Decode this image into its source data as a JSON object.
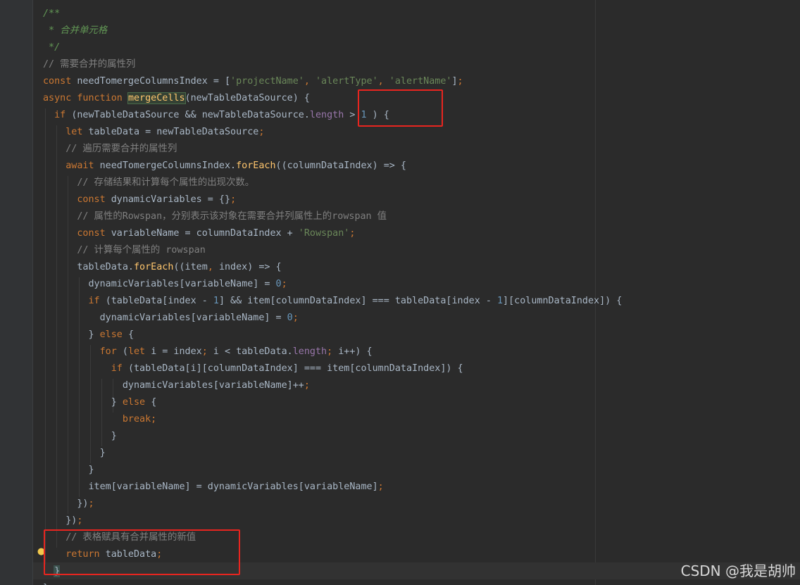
{
  "editor": {
    "theme": "darcula",
    "colors": {
      "background": "#2b2b2b",
      "keyword": "#cc7832",
      "string": "#6a8759",
      "number": "#6897bb",
      "comment": "#808080",
      "doc_comment": "#629755",
      "function": "#ffc66d",
      "property": "#9876aa",
      "default": "#a9b7c6",
      "annotation_box": "#e8251f"
    },
    "lines": [
      {
        "tokens": [
          {
            "k": "doc",
            "t": "/**"
          }
        ]
      },
      {
        "tokens": [
          {
            "k": "doc",
            "t": " * 合并单元格"
          }
        ]
      },
      {
        "tokens": [
          {
            "k": "doc",
            "t": " */"
          }
        ]
      },
      {
        "tokens": [
          {
            "k": "cm",
            "t": "// 需要合并的属性列"
          }
        ]
      },
      {
        "tokens": [
          {
            "k": "kw",
            "t": "const "
          },
          {
            "k": "id",
            "t": "needTomergeColumnsIndex = ["
          },
          {
            "k": "str",
            "t": "'projectName'"
          },
          {
            "k": "kw",
            "t": ", "
          },
          {
            "k": "str",
            "t": "'alertType'"
          },
          {
            "k": "kw",
            "t": ", "
          },
          {
            "k": "str",
            "t": "'alertName'"
          },
          {
            "k": "id",
            "t": "]"
          },
          {
            "k": "kw",
            "t": ";"
          }
        ]
      },
      {
        "tokens": [
          {
            "k": "kw",
            "t": "async function "
          },
          {
            "k": "fnhl",
            "t": "mergeCells"
          },
          {
            "k": "id",
            "t": "(newTableDataSource) {"
          }
        ]
      },
      {
        "tokens": [
          {
            "k": "id",
            "t": "  "
          },
          {
            "k": "kw",
            "t": "if "
          },
          {
            "k": "id",
            "t": "(newTableDataSource && newTableDataSource."
          },
          {
            "k": "prop",
            "t": "length"
          },
          {
            "k": "id",
            "t": " > "
          },
          {
            "k": "num",
            "t": "1"
          },
          {
            "k": "id",
            "t": " ) {"
          }
        ]
      },
      {
        "tokens": [
          {
            "k": "id",
            "t": "    "
          },
          {
            "k": "kw",
            "t": "let "
          },
          {
            "k": "id",
            "t": "tableData = newTableDataSource"
          },
          {
            "k": "kw",
            "t": ";"
          }
        ]
      },
      {
        "tokens": [
          {
            "k": "cm",
            "t": "    // 遍历需要合并的属性列"
          }
        ]
      },
      {
        "tokens": [
          {
            "k": "id",
            "t": "    "
          },
          {
            "k": "kw",
            "t": "await "
          },
          {
            "k": "id",
            "t": "needTomergeColumnsIndex."
          },
          {
            "k": "fn",
            "t": "forEach"
          },
          {
            "k": "id",
            "t": "((columnDataIndex) => {"
          }
        ]
      },
      {
        "tokens": [
          {
            "k": "cm",
            "t": "      // 存储结果和计算每个属性的出现次数。"
          }
        ]
      },
      {
        "tokens": [
          {
            "k": "id",
            "t": "      "
          },
          {
            "k": "kw",
            "t": "const "
          },
          {
            "k": "id",
            "t": "dynamicVariables = {}"
          },
          {
            "k": "kw",
            "t": ";"
          }
        ]
      },
      {
        "tokens": [
          {
            "k": "cm",
            "t": "      // 属性的Rowspan，分别表示该对象在需要合并列属性上的rowspan 值"
          }
        ]
      },
      {
        "tokens": [
          {
            "k": "id",
            "t": "      "
          },
          {
            "k": "kw",
            "t": "const "
          },
          {
            "k": "id",
            "t": "variableName = columnDataIndex + "
          },
          {
            "k": "str",
            "t": "'Rowspan'"
          },
          {
            "k": "kw",
            "t": ";"
          }
        ]
      },
      {
        "tokens": [
          {
            "k": "cm",
            "t": "      // 计算每个属性的 rowspan"
          }
        ]
      },
      {
        "tokens": [
          {
            "k": "id",
            "t": "      tableData."
          },
          {
            "k": "fn",
            "t": "forEach"
          },
          {
            "k": "id",
            "t": "((item"
          },
          {
            "k": "kw",
            "t": ", "
          },
          {
            "k": "id",
            "t": "index) => {"
          }
        ]
      },
      {
        "tokens": [
          {
            "k": "id",
            "t": "        dynamicVariables[variableName] = "
          },
          {
            "k": "num",
            "t": "0"
          },
          {
            "k": "kw",
            "t": ";"
          }
        ]
      },
      {
        "tokens": [
          {
            "k": "id",
            "t": "        "
          },
          {
            "k": "kw",
            "t": "if "
          },
          {
            "k": "id",
            "t": "(tableData[index - "
          },
          {
            "k": "num",
            "t": "1"
          },
          {
            "k": "id",
            "t": "] && item[columnDataIndex] === tableData[index - "
          },
          {
            "k": "num",
            "t": "1"
          },
          {
            "k": "id",
            "t": "][columnDataIndex]) {"
          }
        ]
      },
      {
        "tokens": [
          {
            "k": "id",
            "t": "          dynamicVariables[variableName] = "
          },
          {
            "k": "num",
            "t": "0"
          },
          {
            "k": "kw",
            "t": ";"
          }
        ]
      },
      {
        "tokens": [
          {
            "k": "id",
            "t": "        } "
          },
          {
            "k": "kw",
            "t": "else "
          },
          {
            "k": "id",
            "t": "{"
          }
        ]
      },
      {
        "tokens": [
          {
            "k": "id",
            "t": "          "
          },
          {
            "k": "kw",
            "t": "for "
          },
          {
            "k": "id",
            "t": "("
          },
          {
            "k": "kw",
            "t": "let "
          },
          {
            "k": "id",
            "t": "i = index"
          },
          {
            "k": "kw",
            "t": "; "
          },
          {
            "k": "id",
            "t": "i < tableData."
          },
          {
            "k": "prop",
            "t": "length"
          },
          {
            "k": "kw",
            "t": "; "
          },
          {
            "k": "id",
            "t": "i++) {"
          }
        ]
      },
      {
        "tokens": [
          {
            "k": "id",
            "t": "            "
          },
          {
            "k": "kw",
            "t": "if "
          },
          {
            "k": "id",
            "t": "(tableData[i][columnDataIndex] === item[columnDataIndex]) {"
          }
        ]
      },
      {
        "tokens": [
          {
            "k": "id",
            "t": "              dynamicVariables[variableName]++"
          },
          {
            "k": "kw",
            "t": ";"
          }
        ]
      },
      {
        "tokens": [
          {
            "k": "id",
            "t": "            } "
          },
          {
            "k": "kw",
            "t": "else "
          },
          {
            "k": "id",
            "t": "{"
          }
        ]
      },
      {
        "tokens": [
          {
            "k": "id",
            "t": "              "
          },
          {
            "k": "kw",
            "t": "break;"
          }
        ]
      },
      {
        "tokens": [
          {
            "k": "id",
            "t": "            }"
          }
        ]
      },
      {
        "tokens": [
          {
            "k": "id",
            "t": "          }"
          }
        ]
      },
      {
        "tokens": [
          {
            "k": "id",
            "t": "        }"
          }
        ]
      },
      {
        "tokens": [
          {
            "k": "id",
            "t": "        item[variableName] = dynamicVariables[variableName]"
          },
          {
            "k": "kw",
            "t": ";"
          }
        ]
      },
      {
        "tokens": [
          {
            "k": "id",
            "t": "      })"
          },
          {
            "k": "kw",
            "t": ";"
          }
        ]
      },
      {
        "tokens": [
          {
            "k": "id",
            "t": "    })"
          },
          {
            "k": "kw",
            "t": ";"
          }
        ]
      },
      {
        "tokens": [
          {
            "k": "cm",
            "t": "    // 表格赋具有合并属性的新值"
          }
        ]
      },
      {
        "tokens": [
          {
            "k": "id",
            "t": "    "
          },
          {
            "k": "kw",
            "t": "return "
          },
          {
            "k": "id",
            "t": "tableData"
          },
          {
            "k": "kw",
            "t": ";"
          }
        ]
      },
      {
        "tokens": [
          {
            "k": "id",
            "t": "  }"
          }
        ]
      },
      {
        "tokens": [
          {
            "k": "id",
            "t": "}"
          }
        ]
      }
    ]
  },
  "icons": {
    "intention_bulb": "lightbulb-icon"
  },
  "watermark": {
    "text": "CSDN @我是胡帅"
  }
}
